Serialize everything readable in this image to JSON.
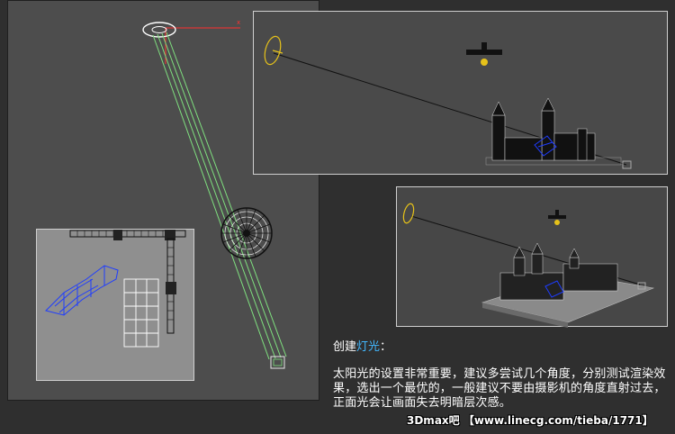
{
  "caption": {
    "heading_prefix": "创建",
    "heading_highlight": "灯光",
    "heading_suffix": "：",
    "body": "太阳光的设置非常重要，建议多尝试几个角度，分别测试渲染效果，选出一个最优的，一般建议不要由摄影机的角度直射过去，正面光会让画面失去明暗层次感。"
  },
  "watermark": "3Dmax吧 【www.linecg.com/tieba/1771】",
  "colors": {
    "background": "#2f2f2f",
    "viewport": "#4d4d4d",
    "highlight_text": "#42b8ff",
    "light_gizmo": "#e6c21a",
    "selection_line": "#7fe07f",
    "model_blue": "#1e3cff"
  },
  "icons": {
    "sun_compass": "compass-rose-icon",
    "light_target": "target-box-icon",
    "light_source": "light-ring-icon",
    "camera": "camera-icon"
  }
}
